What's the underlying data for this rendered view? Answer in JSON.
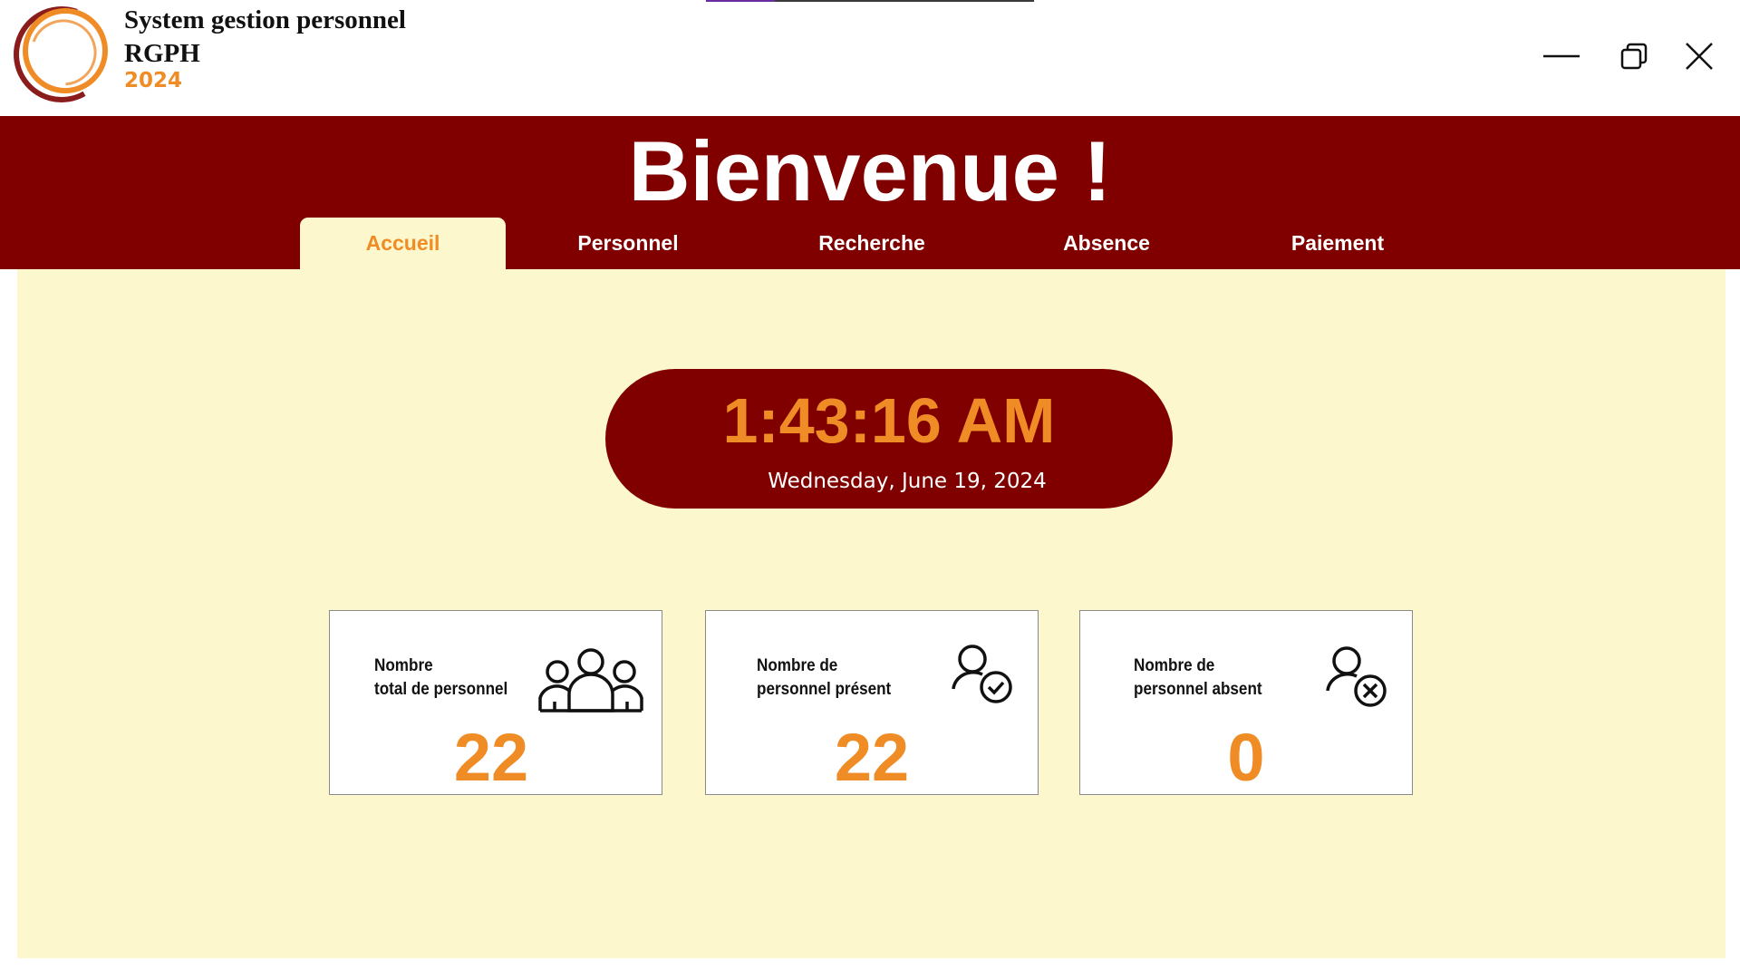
{
  "app": {
    "title_line1": "System gestion personnel",
    "title_line2": "RGPH",
    "year": "2024"
  },
  "window_controls": [
    "minimize-icon",
    "restore-icon",
    "close-icon"
  ],
  "colors": {
    "brand_dark_red": "#800000",
    "accent_orange": "#ef8c25",
    "content_background": "#fdf7cd"
  },
  "header": {
    "welcome": "Bienvenue !"
  },
  "tabs": [
    {
      "label": "Accueil",
      "active": true
    },
    {
      "label": "Personnel",
      "active": false
    },
    {
      "label": "Recherche",
      "active": false
    },
    {
      "label": "Absence",
      "active": false
    },
    {
      "label": "Paiement",
      "active": false
    }
  ],
  "clock": {
    "time": "1:43:16 AM",
    "date": "Wednesday, June 19, 2024"
  },
  "stats": [
    {
      "label_line1": "Nombre",
      "label_line2": "total de personnel",
      "value": "22",
      "icon": "group-icon"
    },
    {
      "label_line1": "Nombre de",
      "label_line2": "personnel présent",
      "value": "22",
      "icon": "user-check-icon"
    },
    {
      "label_line1": "Nombre de",
      "label_line2": "personnel absent",
      "value": "0",
      "icon": "user-cross-icon"
    }
  ]
}
